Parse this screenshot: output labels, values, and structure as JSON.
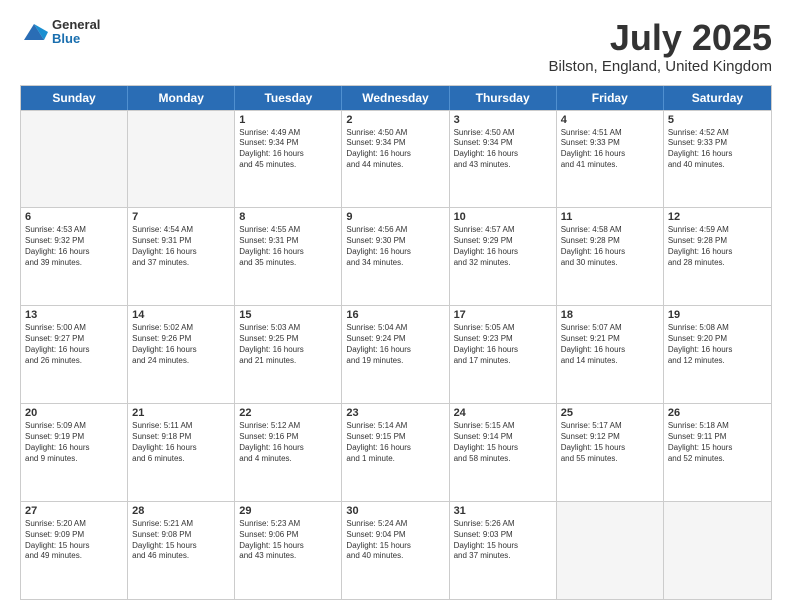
{
  "header": {
    "logo_general": "General",
    "logo_blue": "Blue",
    "month_title": "July 2025",
    "location": "Bilston, England, United Kingdom"
  },
  "days_of_week": [
    "Sunday",
    "Monday",
    "Tuesday",
    "Wednesday",
    "Thursday",
    "Friday",
    "Saturday"
  ],
  "weeks": [
    [
      {
        "day": "",
        "empty": true
      },
      {
        "day": "",
        "empty": true
      },
      {
        "day": "1",
        "sunrise": "Sunrise: 4:49 AM",
        "sunset": "Sunset: 9:34 PM",
        "daylight": "Daylight: 16 hours",
        "minutes": "and 45 minutes."
      },
      {
        "day": "2",
        "sunrise": "Sunrise: 4:50 AM",
        "sunset": "Sunset: 9:34 PM",
        "daylight": "Daylight: 16 hours",
        "minutes": "and 44 minutes."
      },
      {
        "day": "3",
        "sunrise": "Sunrise: 4:50 AM",
        "sunset": "Sunset: 9:34 PM",
        "daylight": "Daylight: 16 hours",
        "minutes": "and 43 minutes."
      },
      {
        "day": "4",
        "sunrise": "Sunrise: 4:51 AM",
        "sunset": "Sunset: 9:33 PM",
        "daylight": "Daylight: 16 hours",
        "minutes": "and 41 minutes."
      },
      {
        "day": "5",
        "sunrise": "Sunrise: 4:52 AM",
        "sunset": "Sunset: 9:33 PM",
        "daylight": "Daylight: 16 hours",
        "minutes": "and 40 minutes."
      }
    ],
    [
      {
        "day": "6",
        "sunrise": "Sunrise: 4:53 AM",
        "sunset": "Sunset: 9:32 PM",
        "daylight": "Daylight: 16 hours",
        "minutes": "and 39 minutes."
      },
      {
        "day": "7",
        "sunrise": "Sunrise: 4:54 AM",
        "sunset": "Sunset: 9:31 PM",
        "daylight": "Daylight: 16 hours",
        "minutes": "and 37 minutes."
      },
      {
        "day": "8",
        "sunrise": "Sunrise: 4:55 AM",
        "sunset": "Sunset: 9:31 PM",
        "daylight": "Daylight: 16 hours",
        "minutes": "and 35 minutes."
      },
      {
        "day": "9",
        "sunrise": "Sunrise: 4:56 AM",
        "sunset": "Sunset: 9:30 PM",
        "daylight": "Daylight: 16 hours",
        "minutes": "and 34 minutes."
      },
      {
        "day": "10",
        "sunrise": "Sunrise: 4:57 AM",
        "sunset": "Sunset: 9:29 PM",
        "daylight": "Daylight: 16 hours",
        "minutes": "and 32 minutes."
      },
      {
        "day": "11",
        "sunrise": "Sunrise: 4:58 AM",
        "sunset": "Sunset: 9:28 PM",
        "daylight": "Daylight: 16 hours",
        "minutes": "and 30 minutes."
      },
      {
        "day": "12",
        "sunrise": "Sunrise: 4:59 AM",
        "sunset": "Sunset: 9:28 PM",
        "daylight": "Daylight: 16 hours",
        "minutes": "and 28 minutes."
      }
    ],
    [
      {
        "day": "13",
        "sunrise": "Sunrise: 5:00 AM",
        "sunset": "Sunset: 9:27 PM",
        "daylight": "Daylight: 16 hours",
        "minutes": "and 26 minutes."
      },
      {
        "day": "14",
        "sunrise": "Sunrise: 5:02 AM",
        "sunset": "Sunset: 9:26 PM",
        "daylight": "Daylight: 16 hours",
        "minutes": "and 24 minutes."
      },
      {
        "day": "15",
        "sunrise": "Sunrise: 5:03 AM",
        "sunset": "Sunset: 9:25 PM",
        "daylight": "Daylight: 16 hours",
        "minutes": "and 21 minutes."
      },
      {
        "day": "16",
        "sunrise": "Sunrise: 5:04 AM",
        "sunset": "Sunset: 9:24 PM",
        "daylight": "Daylight: 16 hours",
        "minutes": "and 19 minutes."
      },
      {
        "day": "17",
        "sunrise": "Sunrise: 5:05 AM",
        "sunset": "Sunset: 9:23 PM",
        "daylight": "Daylight: 16 hours",
        "minutes": "and 17 minutes."
      },
      {
        "day": "18",
        "sunrise": "Sunrise: 5:07 AM",
        "sunset": "Sunset: 9:21 PM",
        "daylight": "Daylight: 16 hours",
        "minutes": "and 14 minutes."
      },
      {
        "day": "19",
        "sunrise": "Sunrise: 5:08 AM",
        "sunset": "Sunset: 9:20 PM",
        "daylight": "Daylight: 16 hours",
        "minutes": "and 12 minutes."
      }
    ],
    [
      {
        "day": "20",
        "sunrise": "Sunrise: 5:09 AM",
        "sunset": "Sunset: 9:19 PM",
        "daylight": "Daylight: 16 hours",
        "minutes": "and 9 minutes."
      },
      {
        "day": "21",
        "sunrise": "Sunrise: 5:11 AM",
        "sunset": "Sunset: 9:18 PM",
        "daylight": "Daylight: 16 hours",
        "minutes": "and 6 minutes."
      },
      {
        "day": "22",
        "sunrise": "Sunrise: 5:12 AM",
        "sunset": "Sunset: 9:16 PM",
        "daylight": "Daylight: 16 hours",
        "minutes": "and 4 minutes."
      },
      {
        "day": "23",
        "sunrise": "Sunrise: 5:14 AM",
        "sunset": "Sunset: 9:15 PM",
        "daylight": "Daylight: 16 hours",
        "minutes": "and 1 minute."
      },
      {
        "day": "24",
        "sunrise": "Sunrise: 5:15 AM",
        "sunset": "Sunset: 9:14 PM",
        "daylight": "Daylight: 15 hours",
        "minutes": "and 58 minutes."
      },
      {
        "day": "25",
        "sunrise": "Sunrise: 5:17 AM",
        "sunset": "Sunset: 9:12 PM",
        "daylight": "Daylight: 15 hours",
        "minutes": "and 55 minutes."
      },
      {
        "day": "26",
        "sunrise": "Sunrise: 5:18 AM",
        "sunset": "Sunset: 9:11 PM",
        "daylight": "Daylight: 15 hours",
        "minutes": "and 52 minutes."
      }
    ],
    [
      {
        "day": "27",
        "sunrise": "Sunrise: 5:20 AM",
        "sunset": "Sunset: 9:09 PM",
        "daylight": "Daylight: 15 hours",
        "minutes": "and 49 minutes."
      },
      {
        "day": "28",
        "sunrise": "Sunrise: 5:21 AM",
        "sunset": "Sunset: 9:08 PM",
        "daylight": "Daylight: 15 hours",
        "minutes": "and 46 minutes."
      },
      {
        "day": "29",
        "sunrise": "Sunrise: 5:23 AM",
        "sunset": "Sunset: 9:06 PM",
        "daylight": "Daylight: 15 hours",
        "minutes": "and 43 minutes."
      },
      {
        "day": "30",
        "sunrise": "Sunrise: 5:24 AM",
        "sunset": "Sunset: 9:04 PM",
        "daylight": "Daylight: 15 hours",
        "minutes": "and 40 minutes."
      },
      {
        "day": "31",
        "sunrise": "Sunrise: 5:26 AM",
        "sunset": "Sunset: 9:03 PM",
        "daylight": "Daylight: 15 hours",
        "minutes": "and 37 minutes."
      },
      {
        "day": "",
        "empty": true
      },
      {
        "day": "",
        "empty": true
      }
    ]
  ]
}
